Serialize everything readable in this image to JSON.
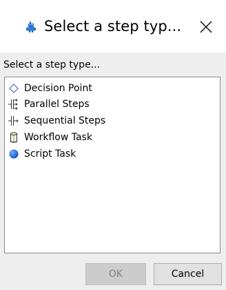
{
  "window": {
    "title": "Select a step typ...",
    "close_glyph": "✕",
    "app_icon": "robot-icon"
  },
  "dialog": {
    "prompt": "Select a step type...",
    "items": [
      {
        "label": "Decision Point",
        "icon": "diamond-icon"
      },
      {
        "label": "Parallel Steps",
        "icon": "parallel-steps-icon"
      },
      {
        "label": "Sequential Steps",
        "icon": "sequential-steps-icon"
      },
      {
        "label": "Workflow Task",
        "icon": "cylinder-icon"
      },
      {
        "label": "Script Task",
        "icon": "blue-circle-icon"
      }
    ],
    "buttons": {
      "ok": "OK",
      "cancel": "Cancel"
    }
  },
  "colors": {
    "dialog_background": "#eeeeee",
    "list_background": "#ffffff",
    "script_task_blue": "#1565d8",
    "disabled_text": "#838383"
  }
}
